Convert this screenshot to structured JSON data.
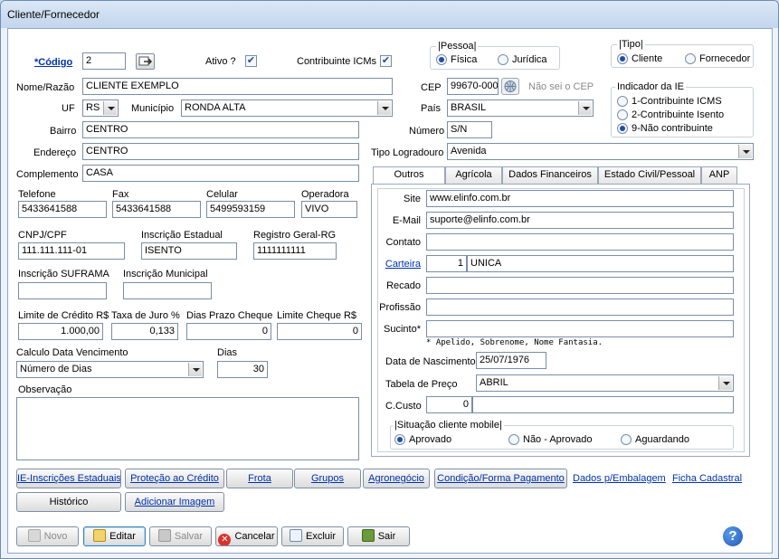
{
  "window": {
    "title": "Cliente/Fornecedor"
  },
  "codigo": {
    "label": "*Código",
    "value": "2"
  },
  "ativo": {
    "label": "Ativo ?",
    "checked": true
  },
  "contribuinte": {
    "label": "Contribuinte ICMs",
    "checked": true
  },
  "pessoa": {
    "label": "Pessoa",
    "options": [
      "Física",
      "Jurídica"
    ],
    "selected": "Física"
  },
  "tipo": {
    "label": "Tipo",
    "options": [
      "Cliente",
      "Fornecedor"
    ],
    "selected": "Cliente"
  },
  "nome": {
    "label": "Nome/Razão",
    "value": "CLIENTE EXEMPLO"
  },
  "cep": {
    "label": "CEP",
    "value": "99670-000",
    "nao_sei": "Não sei o CEP"
  },
  "uf": {
    "label": "UF",
    "value": "RS"
  },
  "municipio": {
    "label": "Município",
    "value": "RONDA ALTA"
  },
  "pais": {
    "label": "País",
    "value": "BRASIL"
  },
  "indicador_ie": {
    "label": "Indicador da IE",
    "options": [
      "1-Contribuinte ICMS",
      "2-Contribuinte Isento",
      "9-Não contribuinte"
    ],
    "selected": "9-Não contribuinte"
  },
  "bairro": {
    "label": "Bairro",
    "value": "CENTRO"
  },
  "numero": {
    "label": "Número",
    "value": "S/N"
  },
  "endereco": {
    "label": "Endereço",
    "value": "CENTRO"
  },
  "tipo_logradouro": {
    "label": "Tipo Logradouro",
    "value": "Avenida"
  },
  "complemento": {
    "label": "Complemento",
    "value": "CASA"
  },
  "telefone": {
    "label": "Telefone",
    "value": "5433641588"
  },
  "fax": {
    "label": "Fax",
    "value": "5433641588"
  },
  "celular": {
    "label": "Celular",
    "value": "5499593159"
  },
  "operadora": {
    "label": "Operadora",
    "value": "VIVO"
  },
  "cnpj": {
    "label": "CNPJ/CPF",
    "value": "111.111.111-01"
  },
  "inscricao_estadual": {
    "label": "Inscrição Estadual",
    "value": "ISENTO"
  },
  "rg": {
    "label": "Registro Geral-RG",
    "value": "1111111111"
  },
  "suframa": {
    "label": "Inscrição SUFRAMA",
    "value": ""
  },
  "inscricao_municipal": {
    "label": "Inscrição Municipal",
    "value": ""
  },
  "limite_credito": {
    "label": "Limite de Crédito R$",
    "value": "1.000,00"
  },
  "taxa_juro": {
    "label": "Taxa de Juro %",
    "value": "0,133"
  },
  "dias_prazo_cheque": {
    "label": "Dias Prazo Cheque",
    "value": "0"
  },
  "limite_cheque": {
    "label": "Limite Cheque R$",
    "value": "0"
  },
  "calculo_vencimento": {
    "label": "Calculo Data Vencimento",
    "value": "Número de Dias"
  },
  "dias": {
    "label": "Dias",
    "value": "30"
  },
  "observacao": {
    "label": "Observação",
    "value": ""
  },
  "tabs": [
    "Outros",
    "Agrícola",
    "Dados Financeiros",
    "Estado Civil/Pessoal",
    "ANP"
  ],
  "outros": {
    "site": {
      "label": "Site",
      "value": "www.elinfo.com.br"
    },
    "email": {
      "label": "E-Mail",
      "value": "suporte@elinfo.com.br"
    },
    "contato": {
      "label": "Contato",
      "value": ""
    },
    "carteira": {
      "label": "Carteira",
      "code": "1",
      "name": "UNICA"
    },
    "recado": {
      "label": "Recado",
      "value": ""
    },
    "profissao": {
      "label": "Profissão",
      "value": ""
    },
    "sucinto": {
      "label": "Sucinto*",
      "value": "",
      "note": "* Apelido, Sobrenome, Nome Fantasia."
    },
    "nascimento": {
      "label": "Data de Nascimento",
      "value": "25/07/1976"
    },
    "tabela_preco": {
      "label": "Tabela de Preço",
      "value": "ABRIL"
    },
    "ccusto": {
      "label": "C.Custo",
      "code": "0",
      "name": ""
    },
    "situacao": {
      "label": "Situação cliente mobile",
      "options": [
        "Aprovado",
        "Não - Aprovado",
        "Aguardando"
      ],
      "selected": "Aprovado"
    }
  },
  "link_buttons": [
    "IE-Inscrições Estaduais",
    "Proteção ao Crédito",
    "Frota",
    "Grupos",
    "Agronegócio",
    "Condição/Forma Pagamento"
  ],
  "plain_links": [
    "Dados p/Embalagem",
    "Ficha Cadastral"
  ],
  "historico": "Histórico",
  "adicionar_imagem": "Adicionar Imagem",
  "actions": {
    "novo": "Novo",
    "editar": "Editar",
    "salvar": "Salvar",
    "cancelar": "Cancelar",
    "excluir": "Excluir",
    "sair": "Sair"
  },
  "help": "?",
  "colors": {
    "link": "#0033aa",
    "window_border": "#6a8cb5",
    "radio_dot": "#1f4f9f"
  }
}
